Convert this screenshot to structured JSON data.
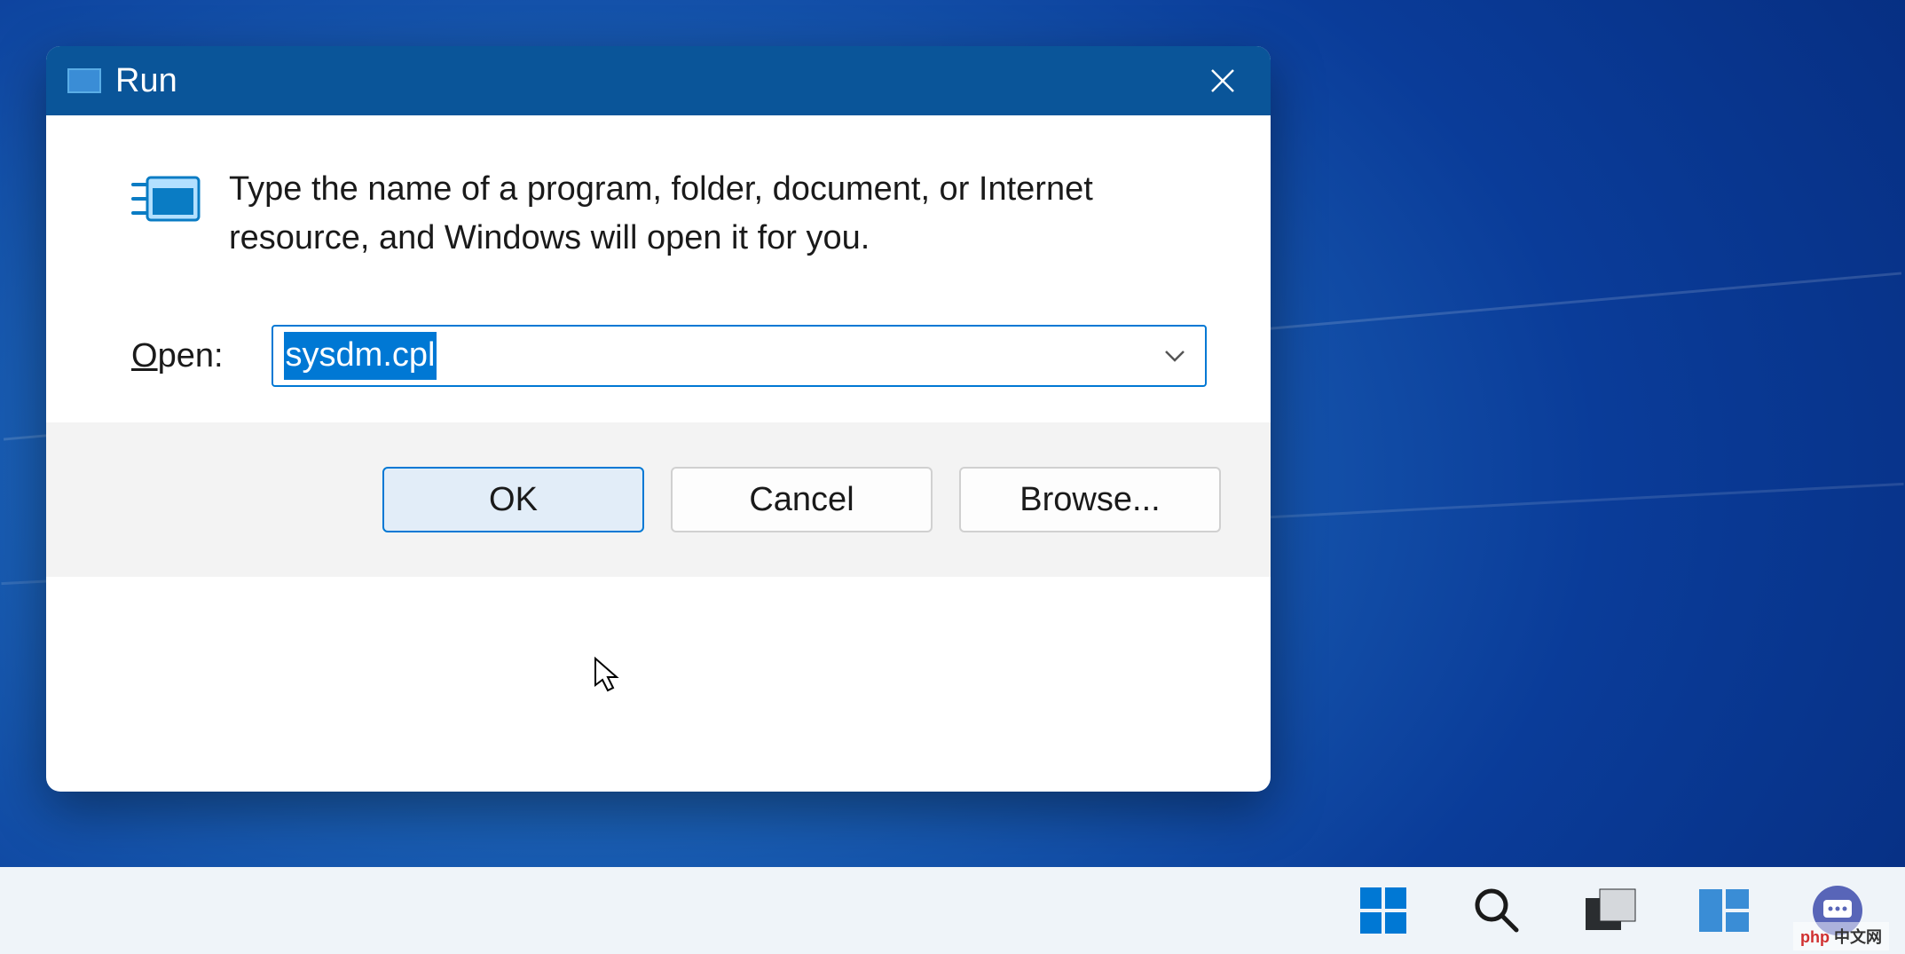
{
  "dialog": {
    "title": "Run",
    "description": "Type the name of a program, folder, document, or Internet resource, and Windows will open it for you.",
    "open_label": "Open:",
    "input_value": "sysdm.cpl",
    "buttons": {
      "ok": "OK",
      "cancel": "Cancel",
      "browse": "Browse..."
    }
  },
  "watermark": "php 中文网"
}
